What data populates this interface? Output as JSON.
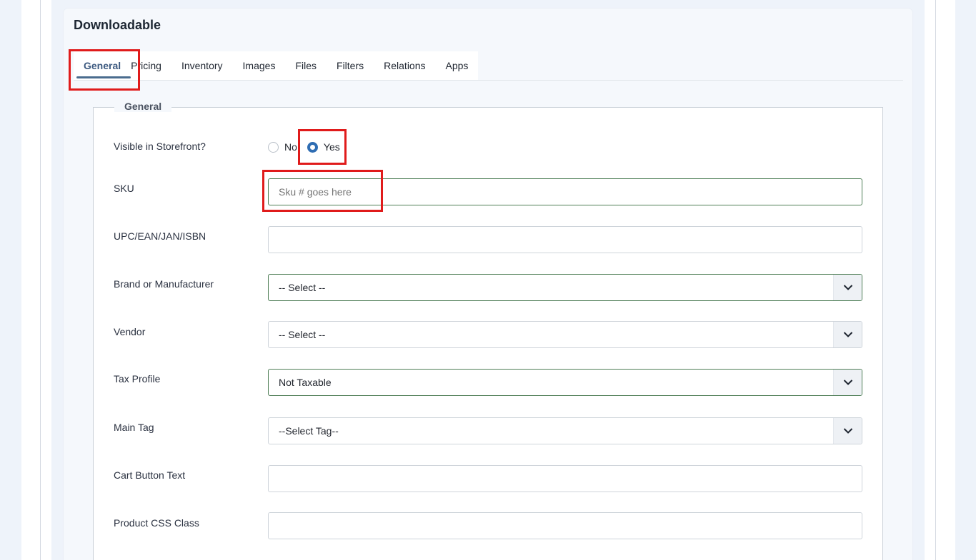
{
  "card": {
    "title": "Downloadable"
  },
  "tabs": [
    {
      "label": "General",
      "active": true
    },
    {
      "label": "Pricing"
    },
    {
      "label": "Inventory"
    },
    {
      "label": "Images"
    },
    {
      "label": "Files"
    },
    {
      "label": "Filters"
    },
    {
      "label": "Relations"
    },
    {
      "label": "Apps"
    }
  ],
  "fieldset": {
    "legend": "General"
  },
  "form": {
    "visible": {
      "label": "Visible in Storefront?",
      "option_no": "No",
      "option_yes": "Yes",
      "selected": "Yes"
    },
    "sku": {
      "label": "SKU",
      "placeholder": "Sku # goes here",
      "value": ""
    },
    "upc": {
      "label": "UPC/EAN/JAN/ISBN",
      "value": ""
    },
    "brand": {
      "label": "Brand or Manufacturer",
      "value": "-- Select --"
    },
    "vendor": {
      "label": "Vendor",
      "value": "-- Select --"
    },
    "tax_profile": {
      "label": "Tax Profile",
      "value": "Not Taxable"
    },
    "main_tag": {
      "label": "Main Tag",
      "value": "--Select Tag--"
    },
    "cart_button_text": {
      "label": "Cart Button Text",
      "value": ""
    },
    "product_css_class": {
      "label": "Product CSS Class",
      "value": ""
    }
  },
  "colors": {
    "highlight": "#e01b1b",
    "accent": "#2f6db3",
    "focus_border": "#4d7d55"
  },
  "icons": {
    "select_arrow": "chevron-down-icon"
  }
}
